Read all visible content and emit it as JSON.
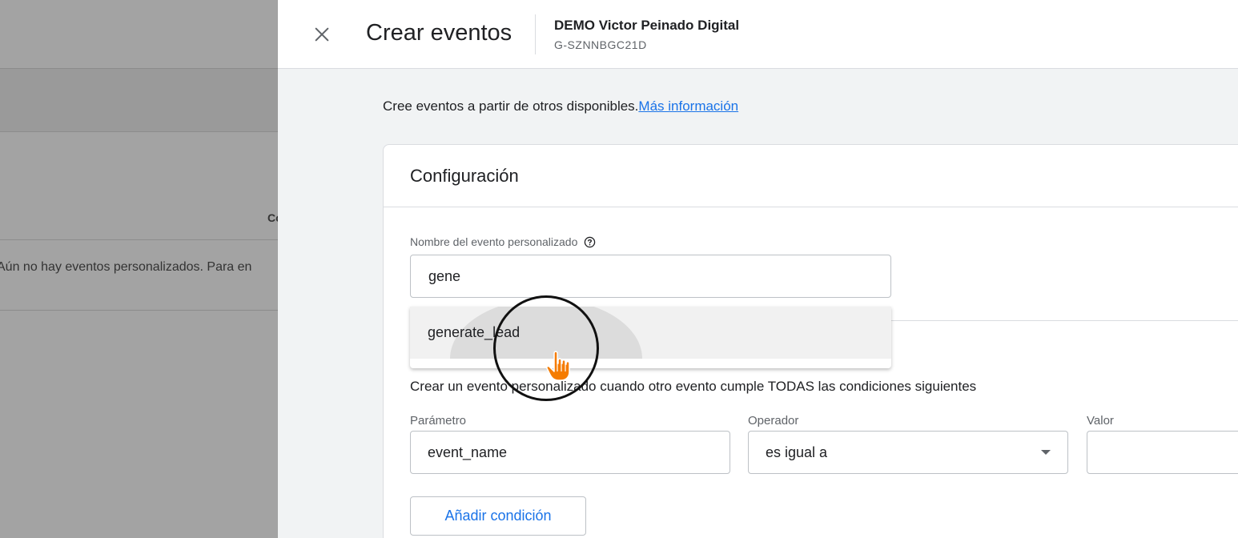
{
  "background": {
    "column_header": "Co",
    "empty_message": "Aún no hay eventos personalizados. Para en"
  },
  "drawer": {
    "close_icon": "close-icon",
    "title": "Crear eventos",
    "property_name": "DEMO Victor Peinado Digital",
    "property_id": "G-SZNNBGC21D",
    "intro_text": "Cree eventos a partir de otros disponibles.",
    "learn_more_link": "Más información"
  },
  "config": {
    "title": "Configuración",
    "name_label": "Nombre del evento personalizado",
    "help_icon": "help-circle-icon",
    "name_value": "gene",
    "autocomplete_option": "generate_lead",
    "condition_text": "Crear un evento personalizado cuando otro evento cumple TODAS las condiciones siguientes",
    "parameter_label": "Parámetro",
    "parameter_value": "event_name",
    "operator_label": "Operador",
    "operator_value": "es igual a",
    "value_label": "Valor",
    "value_value": "",
    "add_condition_label": "Añadir condición"
  },
  "colors": {
    "accent": "#1a73e8",
    "cursor": "#f57c00",
    "overlay": "#9e9e9e"
  }
}
